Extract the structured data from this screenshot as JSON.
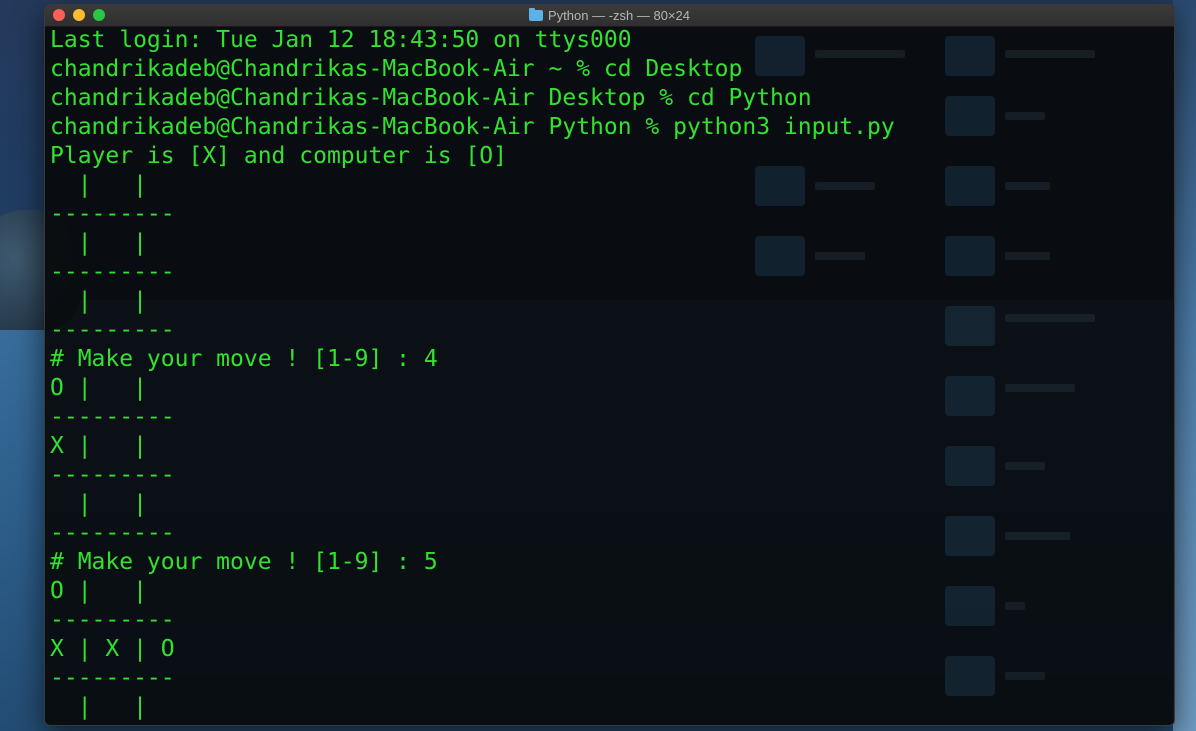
{
  "window": {
    "title": "Python — -zsh — 80×24",
    "folder_icon": "folder-icon"
  },
  "terminal": {
    "text_color": "#32e22f",
    "background": "#080a0c",
    "lines": [
      {
        "text": "Last login: Tue Jan 12 18:43:50 on ttys000",
        "boxed": false
      },
      {
        "text": "chandrikadeb@Chandrikas-MacBook-Air ~ % cd Desktop",
        "boxed": true
      },
      {
        "text": "chandrikadeb@Chandrikas-MacBook-Air Desktop % cd Python",
        "boxed": true
      },
      {
        "text": "chandrikadeb@Chandrikas-MacBook-Air Python % python3 input.py",
        "boxed": true
      },
      {
        "text": "Player is [X] and computer is [O]",
        "boxed": false
      },
      {
        "text": "  |   |",
        "boxed": false
      },
      {
        "text": "---------",
        "boxed": false
      },
      {
        "text": "  |   |",
        "boxed": false
      },
      {
        "text": "---------",
        "boxed": false
      },
      {
        "text": "  |   |",
        "boxed": false
      },
      {
        "text": "---------",
        "boxed": false
      },
      {
        "text": "# Make your move ! [1-9] : 4",
        "boxed": false
      },
      {
        "text": "O |   |",
        "boxed": false
      },
      {
        "text": "---------",
        "boxed": false
      },
      {
        "text": "X |   |",
        "boxed": false
      },
      {
        "text": "---------",
        "boxed": false
      },
      {
        "text": "  |   |",
        "boxed": false
      },
      {
        "text": "---------",
        "boxed": false
      },
      {
        "text": "# Make your move ! [1-9] : 5",
        "boxed": false
      },
      {
        "text": "O |   |",
        "boxed": false
      },
      {
        "text": "---------",
        "boxed": false
      },
      {
        "text": "X | X | O",
        "boxed": false
      },
      {
        "text": "---------",
        "boxed": false
      },
      {
        "text": "  |   |",
        "boxed": false
      }
    ]
  }
}
